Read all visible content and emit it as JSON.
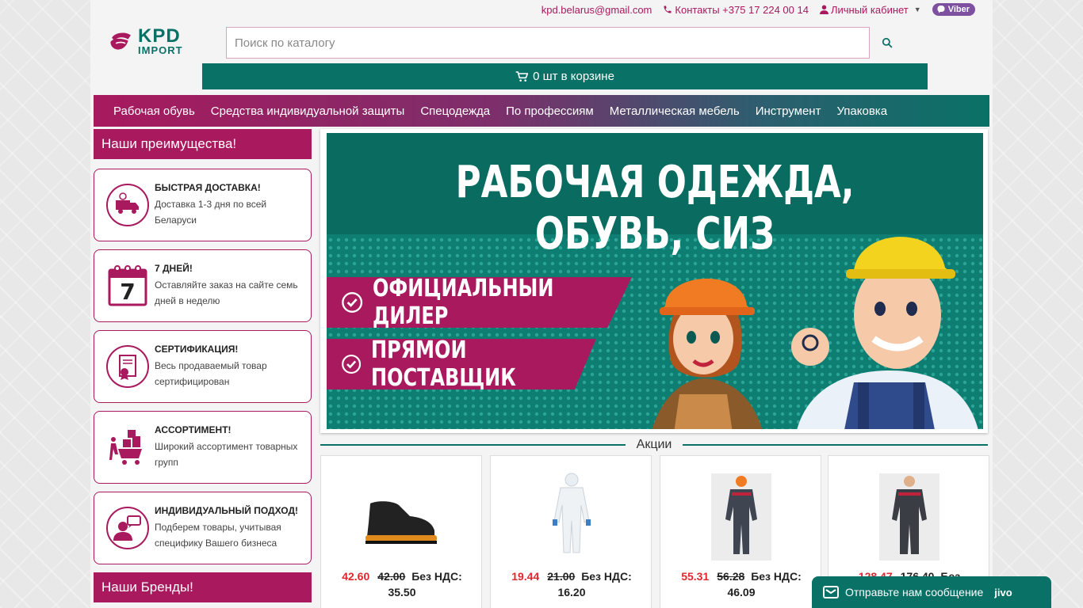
{
  "topbar": {
    "email": "kpd.belarus@gmail.com",
    "contacts": "Контакты +375 17 224 00 14",
    "account": "Личный кабинет",
    "viber": "Viber"
  },
  "logo": {
    "line1": "KPD",
    "line2": "IMPORT"
  },
  "search": {
    "placeholder": "Поиск по каталогу"
  },
  "cart": {
    "label": "0 шт в корзине"
  },
  "nav": [
    "Рабочая обувь",
    "Средства индивидуальной защиты",
    "Спецодежда",
    "По профессиям",
    "Металлическая мебель",
    "Инструмент",
    "Упаковка"
  ],
  "advantages": {
    "title": "Наши преимущества!",
    "items": [
      {
        "title": "БЫСТРАЯ ДОСТАВКА!",
        "desc": "Доставка 1-3 дня по всей Беларуси",
        "icon": "delivery-truck-icon"
      },
      {
        "title": "7 ДНЕЙ!",
        "desc": "Оставляйте заказ на сайте семь дней в неделю",
        "icon": "calendar-icon",
        "calendar_number": "7"
      },
      {
        "title": "СЕРТИФИКАЦИЯ!",
        "desc": "Весь продаваемый товар сертифицирован",
        "icon": "certificate-icon"
      },
      {
        "title": "АССОРТИМЕНТ!",
        "desc": "Широкий ассортимент товарных групп",
        "icon": "cart-boxes-icon"
      },
      {
        "title": "ИНДИВИДУАЛЬНЫЙ ПОДХОД!",
        "desc": "Подберем товары, учитывая специфику Вашего бизнеса",
        "icon": "consultant-icon"
      }
    ]
  },
  "banner": {
    "title": "РАБОЧАЯ ОДЕЖДА, ОБУВЬ, СИЗ",
    "ribbon1": "ОФИЦИАЛЬНЫЙ ДИЛЕР",
    "ribbon2": "ПРЯМОЙ ПОСТАВЩИК"
  },
  "promo": {
    "title": "Акции",
    "products": [
      {
        "price": "42.60",
        "old": "42.00",
        "vat_label": "Без НДС:",
        "vat": "35.50",
        "image": "work-boot"
      },
      {
        "price": "19.44",
        "old": "21.00",
        "vat_label": "Без НДС:",
        "vat": "16.20",
        "image": "protective-coverall"
      },
      {
        "price": "55.31",
        "old": "56.28",
        "vat_label": "Без НДС:",
        "vat": "46.09",
        "image": "worker-suit-orange"
      },
      {
        "price": "128.47",
        "old": "176.40",
        "vat_label": "Без",
        "vat": "",
        "image": "worker-suit-grey"
      }
    ]
  },
  "brands": {
    "title": "Наши Бренды!"
  },
  "chat": {
    "label": "Отправьте нам сообщение",
    "brand": "jivo"
  },
  "colors": {
    "primary": "#a8195e",
    "teal": "#0a7166",
    "price": "#e0262e"
  }
}
